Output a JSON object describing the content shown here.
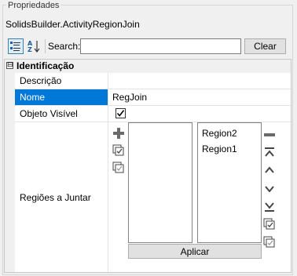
{
  "panel": {
    "title": "Propriedades",
    "object_name": "SolidsBuilder.ActivityRegionJoin"
  },
  "toolbar": {
    "categorized_icon": "categorized-view-icon",
    "alphabetical_icon": "alphabetical-sort-icon",
    "search_label": "Search:",
    "search_value": "",
    "clear_label": "Clear"
  },
  "grid": {
    "category": {
      "label": "Identificação",
      "expander": "⊟"
    },
    "properties": [
      {
        "name": "Descrição",
        "value": ""
      },
      {
        "name": "Nome",
        "value": "RegJoin",
        "selected": true
      },
      {
        "name": "Objeto Visível",
        "value": true
      },
      {
        "name": "Regiões a Juntar"
      }
    ]
  },
  "region_editor": {
    "available": [],
    "selected": [
      "Region2",
      "Region1"
    ],
    "apply_label": "Aplicar",
    "left_icons": [
      "add-icon",
      "select-all-icon",
      "deselect-all-icon"
    ],
    "right_icons": [
      "remove-icon",
      "move-to-top-icon",
      "move-up-icon",
      "move-down-icon",
      "move-to-bottom-icon",
      "select-all-icon",
      "deselect-all-icon"
    ]
  },
  "colors": {
    "selection": "#0078d7",
    "gutter": "#f0f0f0",
    "accent": "#3c7fb1"
  }
}
